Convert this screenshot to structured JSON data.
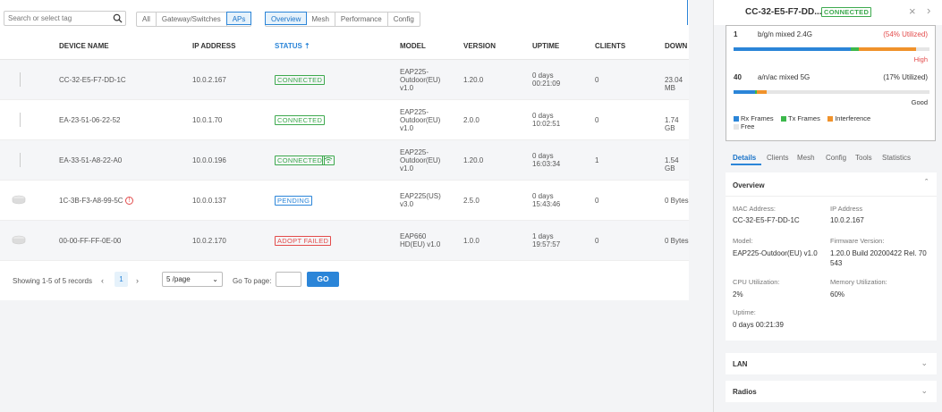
{
  "toolbar": {
    "search_placeholder": "Search or select tag",
    "filter_tabs": [
      "All",
      "Gateway/Switches",
      "APs"
    ],
    "view_tabs": [
      "Overview",
      "Mesh",
      "Performance",
      "Config"
    ]
  },
  "table": {
    "headers": [
      "DEVICE NAME",
      "IP ADDRESS",
      "STATUS",
      "MODEL",
      "VERSION",
      "UPTIME",
      "CLIENTS",
      "DOWN"
    ],
    "status_sort_icon": "sort-up-icon",
    "rows": [
      {
        "name": "CC-32-E5-F7-DD-1C",
        "ip": "10.0.2.167",
        "status": "CONNECTED",
        "status_type": "connected",
        "model1": "EAP225-",
        "model2": "Outdoor(EU)",
        "model3": "v1.0",
        "version": "1.20.0",
        "uptime1": "0 days",
        "uptime2": "00:21:09",
        "clients": "0",
        "down": "23.04 MB",
        "mesh": false,
        "warn": false
      },
      {
        "name": "EA-23-51-06-22-52",
        "ip": "10.0.1.70",
        "status": "CONNECTED",
        "status_type": "connected",
        "model1": "EAP225-",
        "model2": "Outdoor(EU)",
        "model3": "v1.0",
        "version": "2.0.0",
        "uptime1": "0 days",
        "uptime2": "10:02:51",
        "clients": "0",
        "down": "1.74 GB",
        "mesh": false,
        "warn": false
      },
      {
        "name": "EA-33-51-A8-22-A0",
        "ip": "10.0.0.196",
        "status": "CONNECTED",
        "status_type": "connected",
        "model1": "EAP225-",
        "model2": "Outdoor(EU)",
        "model3": "v1.0",
        "version": "1.20.0",
        "uptime1": "0 days",
        "uptime2": "16:03:34",
        "clients": "1",
        "down": "1.54 GB",
        "mesh": true,
        "warn": false
      },
      {
        "name": "1C-3B-F3-A8-99-5C",
        "ip": "10.0.0.137",
        "status": "PENDING",
        "status_type": "pending",
        "model1": "EAP225(US)",
        "model2": "v3.0",
        "model3": "",
        "version": "2.5.0",
        "uptime1": "0 days",
        "uptime2": "15:43:46",
        "clients": "0",
        "down": "0 Bytes",
        "mesh": false,
        "warn": true
      },
      {
        "name": "00-00-FF-FF-0E-00",
        "ip": "10.0.2.170",
        "status": "ADOPT FAILED",
        "status_type": "failed",
        "model1": "EAP660",
        "model2": "HD(EU) v1.0",
        "model3": "",
        "version": "1.0.0",
        "uptime1": "1 days",
        "uptime2": "19:57:57",
        "clients": "0",
        "down": "0 Bytes",
        "mesh": false,
        "warn": false
      }
    ]
  },
  "pager": {
    "summary": "Showing 1-5 of 5 records",
    "page": "1",
    "page_size": "5 /page",
    "goto_label": "Go To page:",
    "go_label": "GO"
  },
  "panel": {
    "title": "CC-32-E5-F7-DD...",
    "status": "CONNECTED",
    "radio1": {
      "channel": "1",
      "mode": "b/g/n mixed  2.4G",
      "util": "(54% Utilized)",
      "level": "High",
      "rx": 0.6,
      "tx": 0.04,
      "interference": 0.29
    },
    "radio2": {
      "channel": "40",
      "mode": "a/n/ac mixed  5G",
      "util": "(17% Utilized)",
      "level": "Good",
      "rx": 0.11,
      "tx": 0.01,
      "interference": 0.05
    },
    "legend": [
      "Rx Frames",
      "Tx Frames",
      "Interference",
      "Free"
    ],
    "colors": {
      "rx": "#2b85d8",
      "tx": "#3cb84b",
      "interference": "#f0922b",
      "free": "#e5e5e5"
    },
    "tabs": [
      "Details",
      "Clients",
      "Mesh",
      "Config",
      "Tools",
      "Statistics"
    ],
    "overview_title": "Overview",
    "details": {
      "mac_label": "MAC Address:",
      "mac": "CC-32-E5-F7-DD-1C",
      "ip_label": "IP Address",
      "ip": "10.0.2.167",
      "model_label": "Model:",
      "model": "EAP225-Outdoor(EU) v1.0",
      "fw_label": "Firmware Version:",
      "fw1": "1.20.0 Build 20200422 Rel. 70",
      "fw2": "543",
      "cpu_label": "CPU Utilization:",
      "cpu": "2%",
      "mem_label": "Memory Utilization:",
      "mem": "60%",
      "uptime_label": "Uptime:",
      "uptime": "0 days 00:21:39"
    },
    "lan_title": "LAN",
    "radios_title": "Radios"
  }
}
